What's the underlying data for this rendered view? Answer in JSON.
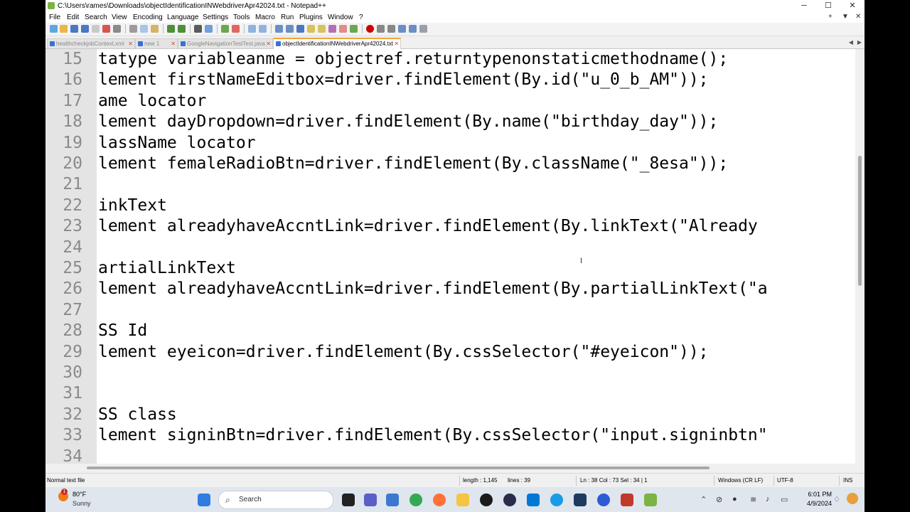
{
  "window": {
    "title": "C:\\Users\\rames\\Downloads\\objectIdentificationINWebdriverApr42024.txt - Notepad++",
    "controls": {
      "minimize": "─",
      "maximize": "☐",
      "close": "✕"
    }
  },
  "menu": {
    "items": [
      "File",
      "Edit",
      "Search",
      "View",
      "Encoding",
      "Language",
      "Settings",
      "Tools",
      "Macro",
      "Run",
      "Plugins",
      "Window",
      "?"
    ],
    "right_controls": [
      "+",
      "▼",
      "✕"
    ]
  },
  "tabs": [
    {
      "label": "healthcheckjobContext.xml",
      "active": false
    },
    {
      "label": "new 1",
      "active": false
    },
    {
      "label": "GoogleNavigationTestTest.java",
      "active": false
    },
    {
      "label": "objectIdentificationINWebdriverApr42024.txt",
      "active": true
    }
  ],
  "editor": {
    "lines": [
      {
        "num": "15",
        "text": "tatype variableanme = objectref.returntypenonstaticmethodname();"
      },
      {
        "num": "16",
        "text": "lement firstNameEditbox=driver.findElement(By.id(\"u_0_b_AM\"));"
      },
      {
        "num": "17",
        "text": "ame locator"
      },
      {
        "num": "18",
        "text": "lement dayDropdown=driver.findElement(By.name(\"birthday_day\"));"
      },
      {
        "num": "19",
        "text": "lassName locator"
      },
      {
        "num": "20",
        "text": "lement femaleRadioBtn=driver.findElement(By.className(\"_8esa\"));"
      },
      {
        "num": "21",
        "text": ""
      },
      {
        "num": "22",
        "text": "inkText"
      },
      {
        "num": "23",
        "text": "lement alreadyhaveAccntLink=driver.findElement(By.linkText(\"Already"
      },
      {
        "num": "24",
        "text": ""
      },
      {
        "num": "25",
        "text": "artialLinkText"
      },
      {
        "num": "26",
        "text": "lement alreadyhaveAccntLink=driver.findElement(By.partialLinkText(\"a"
      },
      {
        "num": "27",
        "text": ""
      },
      {
        "num": "28",
        "text": "SS Id"
      },
      {
        "num": "29",
        "text": "lement eyeicon=driver.findElement(By.cssSelector(\"#eyeicon\"));"
      },
      {
        "num": "30",
        "text": ""
      },
      {
        "num": "31",
        "text": ""
      },
      {
        "num": "32",
        "text": "SS class"
      },
      {
        "num": "33",
        "text": "lement signinBtn=driver.findElement(By.cssSelector(\"input.signinbtn\""
      },
      {
        "num": "34",
        "text": ""
      }
    ]
  },
  "status": {
    "file_type": "Normal text file",
    "length": "length : 1,145",
    "lines": "lines : 39",
    "position": "Ln : 38    Col : 73    Sel : 34 | 1",
    "eol": "Windows (CR LF)",
    "encoding": "UTF-8",
    "mode": "INS"
  },
  "taskbar": {
    "weather_temp": "80°F",
    "weather_cond": "Sunny",
    "weather_badge": "1",
    "search_placeholder": "Search",
    "time": "6:01 PM",
    "date": "4/9/2024"
  }
}
